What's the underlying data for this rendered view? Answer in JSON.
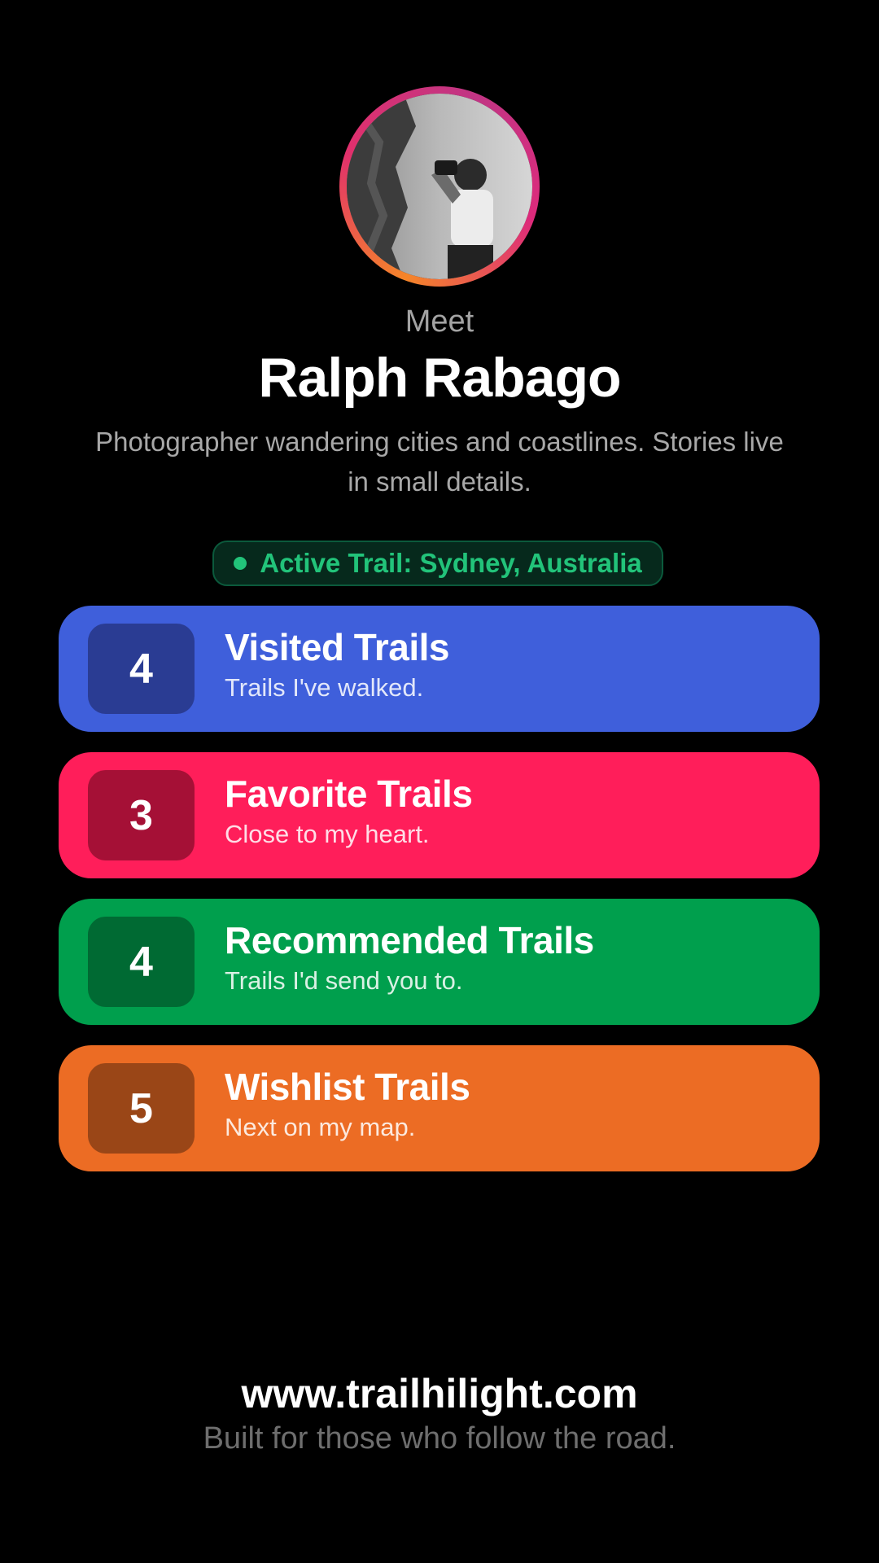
{
  "profile": {
    "meet_label": "Meet",
    "name": "Ralph Rabago",
    "bio": "Photographer wandering cities and coastlines. Stories live in small details.",
    "avatar_icon": "profile-photo"
  },
  "active_trail": {
    "label": "Active Trail: Sydney, Australia",
    "status_color": "#22c37a"
  },
  "trail_cards": [
    {
      "count": "4",
      "title": "Visited Trails",
      "subtitle": "Trails I've walked.",
      "color": "#3f5fdb",
      "badge_color": "#2a3c93"
    },
    {
      "count": "3",
      "title": "Favorite Trails",
      "subtitle": "Close to my heart.",
      "color": "#ff1e5a",
      "badge_color": "#a51036"
    },
    {
      "count": "4",
      "title": "Recommended Trails",
      "subtitle": "Trails I'd send you to.",
      "color": "#009f4d",
      "badge_color": "#006a33"
    },
    {
      "count": "5",
      "title": "Wishlist Trails",
      "subtitle": "Next on my map.",
      "color": "#ec6c24",
      "badge_color": "#9a4617"
    }
  ],
  "footer": {
    "url": "www.trailhilight.com",
    "tagline": "Built for those who follow the road."
  }
}
